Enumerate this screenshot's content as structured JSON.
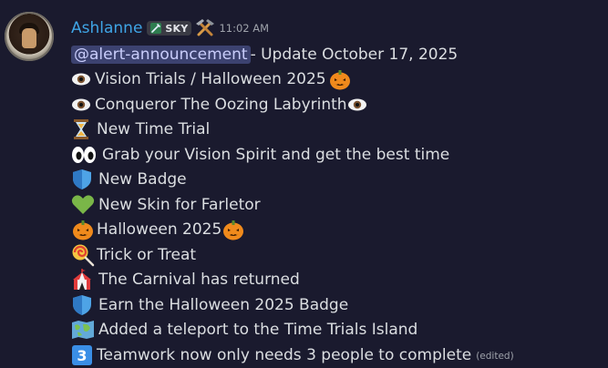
{
  "author": {
    "name": "Ashlanne",
    "tag": "SKY",
    "time": "11:02 AM"
  },
  "message": {
    "mention": "@alert-announcement",
    "header_text": " - Update October 17, 2025",
    "lines": [
      {
        "icon": "eye-emoji",
        "text": "Vision Trials / Halloween 2025",
        "trail_icon": "pumpkin-emoji"
      },
      {
        "icon": "eye-emoji",
        "text": "Conqueror The Oozing Labyrinth",
        "trail_icon": "eye-emoji"
      },
      {
        "icon": "hourglass-emoji",
        "text": "New Time Trial"
      },
      {
        "icon": "eyes-emoji",
        "text": "Grab your Vision Spirit and get the best time"
      },
      {
        "icon": "shield-emoji",
        "text": "New Badge"
      },
      {
        "icon": "green-heart-emoji",
        "text": "New Skin for Farletor"
      },
      {
        "icon": "pumpkin-emoji",
        "text": "Halloween 2025",
        "trail_icon": "pumpkin-emoji"
      },
      {
        "icon": "lollipop-emoji",
        "text": "Trick or Treat"
      },
      {
        "icon": "circus-tent-emoji",
        "text": "The Carnival has returned"
      },
      {
        "icon": "shield-emoji",
        "text": "Earn the Halloween 2025 Badge"
      },
      {
        "icon": "world-map-emoji",
        "text": "Added a teleport to the Time Trials Island"
      },
      {
        "icon": "keycap-3-emoji",
        "text": "Teamwork now only needs 3 people to complete"
      }
    ],
    "edited": "(edited)"
  },
  "colors": {
    "background": "#1a1a2e",
    "username": "#3fa5e6",
    "mention_bg": "#3c4270",
    "mention_text": "#c9cdfb",
    "text": "#dbdee1",
    "muted": "#9ea2aa"
  }
}
